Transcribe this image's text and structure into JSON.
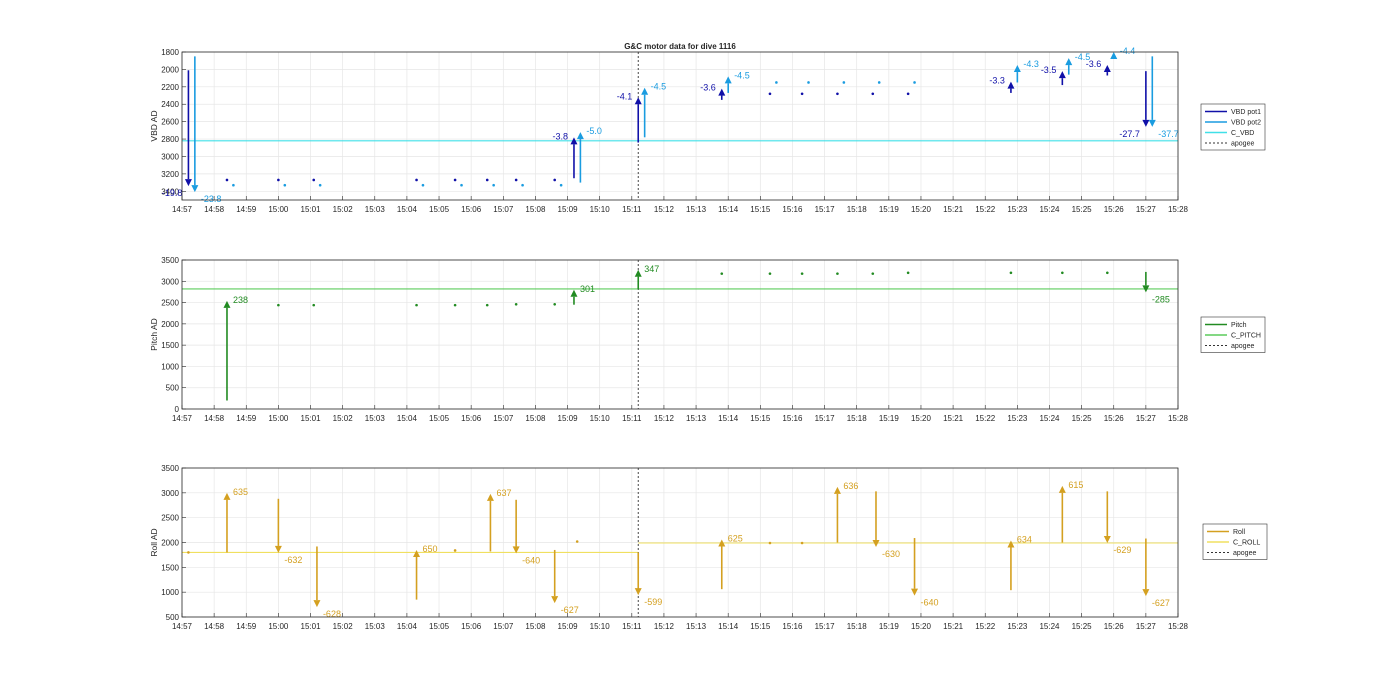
{
  "figure": {
    "title": "G&C motor data for dive 1116"
  },
  "time_ticks": [
    "14:57",
    "14:58",
    "14:59",
    "15:00",
    "15:01",
    "15:02",
    "15:03",
    "15:04",
    "15:05",
    "15:06",
    "15:07",
    "15:08",
    "15:09",
    "15:10",
    "15:11",
    "15:12",
    "15:13",
    "15:14",
    "15:15",
    "15:16",
    "15:17",
    "15:18",
    "15:19",
    "15:20",
    "15:21",
    "15:22",
    "15:23",
    "15:24",
    "15:25",
    "15:26",
    "15:27",
    "15:28"
  ],
  "colors": {
    "vbd_pot1": "#1010a8",
    "vbd_pot2": "#1a9ce0",
    "c_vbd": "#40e0e8",
    "pitch": "#228b22",
    "c_pitch": "#5ccc5c",
    "roll": "#d4a020",
    "c_roll": "#f0e060",
    "apogee": "#333333",
    "grid": "#e6e6e6",
    "axis": "#262626"
  },
  "chart_data": [
    {
      "type": "line",
      "ylabel": "VBD AD",
      "xlim": [
        "14:57",
        "15:28"
      ],
      "ylim": [
        1800,
        3500
      ],
      "y_reversed": true,
      "yticks": [
        1800,
        2000,
        2200,
        2400,
        2600,
        2800,
        3000,
        3200,
        3400
      ],
      "grid": true,
      "legend": [
        "VBD pot1",
        "VBD pot2",
        "C_VBD",
        "apogee"
      ],
      "legend_placement": "right",
      "apogee_time": "15:11.2",
      "reference_line": {
        "name": "C_VBD",
        "value": 2820
      },
      "arrows": [
        {
          "series": "VBD pot1",
          "t": "14:57.2",
          "from": 2010,
          "to": 3340,
          "label": "-19.8"
        },
        {
          "series": "VBD pot2",
          "t": "14:57.4",
          "from": 1850,
          "to": 3410,
          "label": "-23.8"
        },
        {
          "series": "VBD pot1",
          "t": "15:09.2",
          "from": 3250,
          "to": 2780,
          "label": "-3.8"
        },
        {
          "series": "VBD pot2",
          "t": "15:09.4",
          "from": 3300,
          "to": 2720,
          "label": "-5.0"
        },
        {
          "series": "VBD pot1",
          "t": "15:11.2",
          "from": 2840,
          "to": 2320,
          "label": "-4.1"
        },
        {
          "series": "VBD pot2",
          "t": "15:11.4",
          "from": 2780,
          "to": 2210,
          "label": "-4.5"
        },
        {
          "series": "VBD pot1",
          "t": "15:13.8",
          "from": 2350,
          "to": 2220,
          "label": "-3.6"
        },
        {
          "series": "VBD pot2",
          "t": "15:14.0",
          "from": 2270,
          "to": 2080,
          "label": "-4.5"
        },
        {
          "series": "VBD pot1",
          "t": "15:22.8",
          "from": 2270,
          "to": 2140,
          "label": "-3.3"
        },
        {
          "series": "VBD pot2",
          "t": "15:23.0",
          "from": 2150,
          "to": 1950,
          "label": "-4.3"
        },
        {
          "series": "VBD pot1",
          "t": "15:24.4",
          "from": 2180,
          "to": 2020,
          "label": "-3.5"
        },
        {
          "series": "VBD pot2",
          "t": "15:24.6",
          "from": 2060,
          "to": 1870,
          "label": "-4.5"
        },
        {
          "series": "VBD pot1",
          "t": "15:25.8",
          "from": 2070,
          "to": 1950,
          "label": "-3.6"
        },
        {
          "series": "VBD pot2",
          "t": "15:26.0",
          "from": 1880,
          "to": 1750,
          "label": "-4.4"
        },
        {
          "series": "VBD pot1",
          "t": "15:27.0",
          "from": 2020,
          "to": 2660,
          "label": "-27.7"
        },
        {
          "series": "VBD pot2",
          "t": "15:27.2",
          "from": 1850,
          "to": 2660,
          "label": "-37.7"
        }
      ],
      "points": [
        {
          "series": "VBD pot1",
          "x": [
            "14:58.4",
            "15:00.0",
            "15:01.1",
            "15:04.3",
            "15:05.5",
            "15:06.5",
            "15:07.4",
            "15:08.6",
            "15:15.3",
            "15:16.3",
            "15:17.4",
            "15:18.5",
            "15:19.6"
          ],
          "y": [
            3270,
            3270,
            3270,
            3270,
            3270,
            3270,
            3270,
            3270,
            2280,
            2280,
            2280,
            2280,
            2280
          ]
        },
        {
          "series": "VBD pot2",
          "x": [
            "14:58.6",
            "15:00.2",
            "15:01.3",
            "15:04.5",
            "15:05.7",
            "15:06.7",
            "15:07.6",
            "15:08.8",
            "15:15.5",
            "15:16.5",
            "15:17.6",
            "15:18.7",
            "15:19.8"
          ],
          "y": [
            3330,
            3330,
            3330,
            3330,
            3330,
            3330,
            3330,
            3330,
            2150,
            2150,
            2150,
            2150,
            2150
          ]
        }
      ]
    },
    {
      "type": "line",
      "ylabel": "Pitch AD",
      "xlim": [
        "14:57",
        "15:28"
      ],
      "ylim": [
        0,
        3500
      ],
      "yticks": [
        0,
        500,
        1000,
        1500,
        2000,
        2500,
        3000,
        3500
      ],
      "grid": true,
      "legend": [
        "Pitch",
        "C_PITCH",
        "apogee"
      ],
      "legend_placement": "right",
      "apogee_time": "15:11.2",
      "reference_line": {
        "name": "C_PITCH",
        "value": 2820
      },
      "arrows": [
        {
          "series": "Pitch",
          "t": "14:58.4",
          "from": 200,
          "to": 2540,
          "label": "238"
        },
        {
          "series": "Pitch",
          "t": "15:09.2",
          "from": 2450,
          "to": 2800,
          "label": "301"
        },
        {
          "series": "Pitch",
          "t": "15:11.2",
          "from": 2820,
          "to": 3270,
          "label": "347"
        },
        {
          "series": "Pitch",
          "t": "15:27.0",
          "from": 3220,
          "to": 2740,
          "label": "-285"
        }
      ],
      "points": [
        {
          "series": "Pitch",
          "x": [
            "15:00.0",
            "15:01.1",
            "15:04.3",
            "15:05.5",
            "15:06.5",
            "15:07.4",
            "15:08.6",
            "15:13.8",
            "15:15.3",
            "15:16.3",
            "15:17.4",
            "15:18.5",
            "15:19.6",
            "15:22.8",
            "15:24.4",
            "15:25.8"
          ],
          "y": [
            2440,
            2440,
            2440,
            2440,
            2440,
            2460,
            2460,
            3180,
            3180,
            3180,
            3180,
            3180,
            3200,
            3200,
            3200,
            3200
          ]
        }
      ]
    },
    {
      "type": "line",
      "ylabel": "Roll AD",
      "xlim": [
        "14:57",
        "15:28"
      ],
      "ylim": [
        500,
        3500
      ],
      "yticks": [
        500,
        1000,
        1500,
        2000,
        2500,
        3000,
        3500
      ],
      "grid": true,
      "legend": [
        "Roll",
        "C_ROLL",
        "apogee"
      ],
      "legend_placement": "right",
      "apogee_time": "15:11.2",
      "reference_segments": [
        {
          "name": "C_ROLL",
          "t0": "14:57",
          "t1": "15:11.2",
          "value": 1800
        },
        {
          "name": "C_ROLL",
          "t0": "15:11.2",
          "t1": "15:28",
          "value": 1990
        }
      ],
      "arrows": [
        {
          "series": "Roll",
          "t": "14:58.4",
          "from": 1800,
          "to": 3000,
          "label": "635"
        },
        {
          "series": "Roll",
          "t": "15:00.0",
          "from": 2880,
          "to": 1790,
          "label": "-632"
        },
        {
          "series": "Roll",
          "t": "15:01.2",
          "from": 1920,
          "to": 700,
          "label": "-628"
        },
        {
          "series": "Roll",
          "t": "15:04.3",
          "from": 850,
          "to": 1850,
          "label": "650"
        },
        {
          "series": "Roll",
          "t": "15:06.6",
          "from": 1820,
          "to": 2980,
          "label": "637"
        },
        {
          "series": "Roll",
          "t": "15:07.4",
          "from": 2860,
          "to": 1780,
          "label": "-640"
        },
        {
          "series": "Roll",
          "t": "15:08.6",
          "from": 1850,
          "to": 780,
          "label": "-627"
        },
        {
          "series": "Roll",
          "t": "15:11.2",
          "from": 1800,
          "to": 940,
          "label": "-599"
        },
        {
          "series": "Roll",
          "t": "15:13.8",
          "from": 1060,
          "to": 2060,
          "label": "625"
        },
        {
          "series": "Roll",
          "t": "15:17.4",
          "from": 2000,
          "to": 3120,
          "label": "636"
        },
        {
          "series": "Roll",
          "t": "15:18.6",
          "from": 3030,
          "to": 1910,
          "label": "-630"
        },
        {
          "series": "Roll",
          "t": "15:19.8",
          "from": 2090,
          "to": 930,
          "label": "-640"
        },
        {
          "series": "Roll",
          "t": "15:22.8",
          "from": 1040,
          "to": 2040,
          "label": "634"
        },
        {
          "series": "Roll",
          "t": "15:24.4",
          "from": 2000,
          "to": 3140,
          "label": "615"
        },
        {
          "series": "Roll",
          "t": "15:25.8",
          "from": 3030,
          "to": 1990,
          "label": "-629"
        },
        {
          "series": "Roll",
          "t": "15:27.0",
          "from": 2080,
          "to": 920,
          "label": "-627"
        }
      ],
      "points": [
        {
          "series": "Roll",
          "x": [
            "14:57.2",
            "15:05.5",
            "15:09.3",
            "15:15.3",
            "15:16.3"
          ],
          "y": [
            1800,
            1840,
            2020,
            1990,
            1990
          ]
        }
      ]
    }
  ]
}
